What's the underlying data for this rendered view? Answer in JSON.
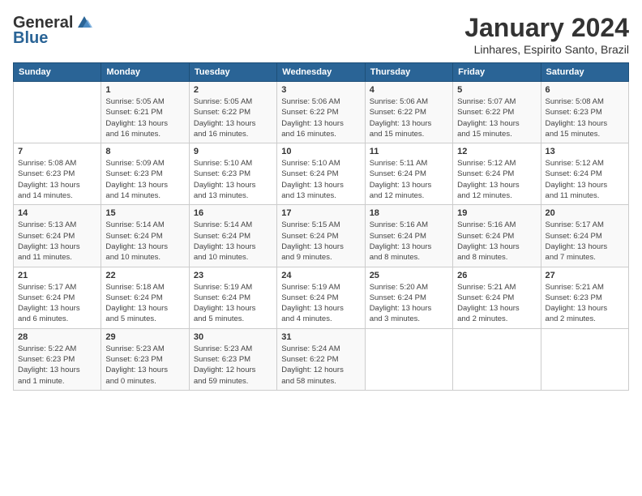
{
  "logo": {
    "general": "General",
    "blue": "Blue"
  },
  "title": "January 2024",
  "subtitle": "Linhares, Espirito Santo, Brazil",
  "days_of_week": [
    "Sunday",
    "Monday",
    "Tuesday",
    "Wednesday",
    "Thursday",
    "Friday",
    "Saturday"
  ],
  "weeks": [
    [
      {
        "day": "",
        "info": ""
      },
      {
        "day": "1",
        "info": "Sunrise: 5:05 AM\nSunset: 6:21 PM\nDaylight: 13 hours\nand 16 minutes."
      },
      {
        "day": "2",
        "info": "Sunrise: 5:05 AM\nSunset: 6:22 PM\nDaylight: 13 hours\nand 16 minutes."
      },
      {
        "day": "3",
        "info": "Sunrise: 5:06 AM\nSunset: 6:22 PM\nDaylight: 13 hours\nand 16 minutes."
      },
      {
        "day": "4",
        "info": "Sunrise: 5:06 AM\nSunset: 6:22 PM\nDaylight: 13 hours\nand 15 minutes."
      },
      {
        "day": "5",
        "info": "Sunrise: 5:07 AM\nSunset: 6:22 PM\nDaylight: 13 hours\nand 15 minutes."
      },
      {
        "day": "6",
        "info": "Sunrise: 5:08 AM\nSunset: 6:23 PM\nDaylight: 13 hours\nand 15 minutes."
      }
    ],
    [
      {
        "day": "7",
        "info": "Sunrise: 5:08 AM\nSunset: 6:23 PM\nDaylight: 13 hours\nand 14 minutes."
      },
      {
        "day": "8",
        "info": "Sunrise: 5:09 AM\nSunset: 6:23 PM\nDaylight: 13 hours\nand 14 minutes."
      },
      {
        "day": "9",
        "info": "Sunrise: 5:10 AM\nSunset: 6:23 PM\nDaylight: 13 hours\nand 13 minutes."
      },
      {
        "day": "10",
        "info": "Sunrise: 5:10 AM\nSunset: 6:24 PM\nDaylight: 13 hours\nand 13 minutes."
      },
      {
        "day": "11",
        "info": "Sunrise: 5:11 AM\nSunset: 6:24 PM\nDaylight: 13 hours\nand 12 minutes."
      },
      {
        "day": "12",
        "info": "Sunrise: 5:12 AM\nSunset: 6:24 PM\nDaylight: 13 hours\nand 12 minutes."
      },
      {
        "day": "13",
        "info": "Sunrise: 5:12 AM\nSunset: 6:24 PM\nDaylight: 13 hours\nand 11 minutes."
      }
    ],
    [
      {
        "day": "14",
        "info": "Sunrise: 5:13 AM\nSunset: 6:24 PM\nDaylight: 13 hours\nand 11 minutes."
      },
      {
        "day": "15",
        "info": "Sunrise: 5:14 AM\nSunset: 6:24 PM\nDaylight: 13 hours\nand 10 minutes."
      },
      {
        "day": "16",
        "info": "Sunrise: 5:14 AM\nSunset: 6:24 PM\nDaylight: 13 hours\nand 10 minutes."
      },
      {
        "day": "17",
        "info": "Sunrise: 5:15 AM\nSunset: 6:24 PM\nDaylight: 13 hours\nand 9 minutes."
      },
      {
        "day": "18",
        "info": "Sunrise: 5:16 AM\nSunset: 6:24 PM\nDaylight: 13 hours\nand 8 minutes."
      },
      {
        "day": "19",
        "info": "Sunrise: 5:16 AM\nSunset: 6:24 PM\nDaylight: 13 hours\nand 8 minutes."
      },
      {
        "day": "20",
        "info": "Sunrise: 5:17 AM\nSunset: 6:24 PM\nDaylight: 13 hours\nand 7 minutes."
      }
    ],
    [
      {
        "day": "21",
        "info": "Sunrise: 5:17 AM\nSunset: 6:24 PM\nDaylight: 13 hours\nand 6 minutes."
      },
      {
        "day": "22",
        "info": "Sunrise: 5:18 AM\nSunset: 6:24 PM\nDaylight: 13 hours\nand 5 minutes."
      },
      {
        "day": "23",
        "info": "Sunrise: 5:19 AM\nSunset: 6:24 PM\nDaylight: 13 hours\nand 5 minutes."
      },
      {
        "day": "24",
        "info": "Sunrise: 5:19 AM\nSunset: 6:24 PM\nDaylight: 13 hours\nand 4 minutes."
      },
      {
        "day": "25",
        "info": "Sunrise: 5:20 AM\nSunset: 6:24 PM\nDaylight: 13 hours\nand 3 minutes."
      },
      {
        "day": "26",
        "info": "Sunrise: 5:21 AM\nSunset: 6:24 PM\nDaylight: 13 hours\nand 2 minutes."
      },
      {
        "day": "27",
        "info": "Sunrise: 5:21 AM\nSunset: 6:23 PM\nDaylight: 13 hours\nand 2 minutes."
      }
    ],
    [
      {
        "day": "28",
        "info": "Sunrise: 5:22 AM\nSunset: 6:23 PM\nDaylight: 13 hours\nand 1 minute."
      },
      {
        "day": "29",
        "info": "Sunrise: 5:23 AM\nSunset: 6:23 PM\nDaylight: 13 hours\nand 0 minutes."
      },
      {
        "day": "30",
        "info": "Sunrise: 5:23 AM\nSunset: 6:23 PM\nDaylight: 12 hours\nand 59 minutes."
      },
      {
        "day": "31",
        "info": "Sunrise: 5:24 AM\nSunset: 6:22 PM\nDaylight: 12 hours\nand 58 minutes."
      },
      {
        "day": "",
        "info": ""
      },
      {
        "day": "",
        "info": ""
      },
      {
        "day": "",
        "info": ""
      }
    ]
  ]
}
